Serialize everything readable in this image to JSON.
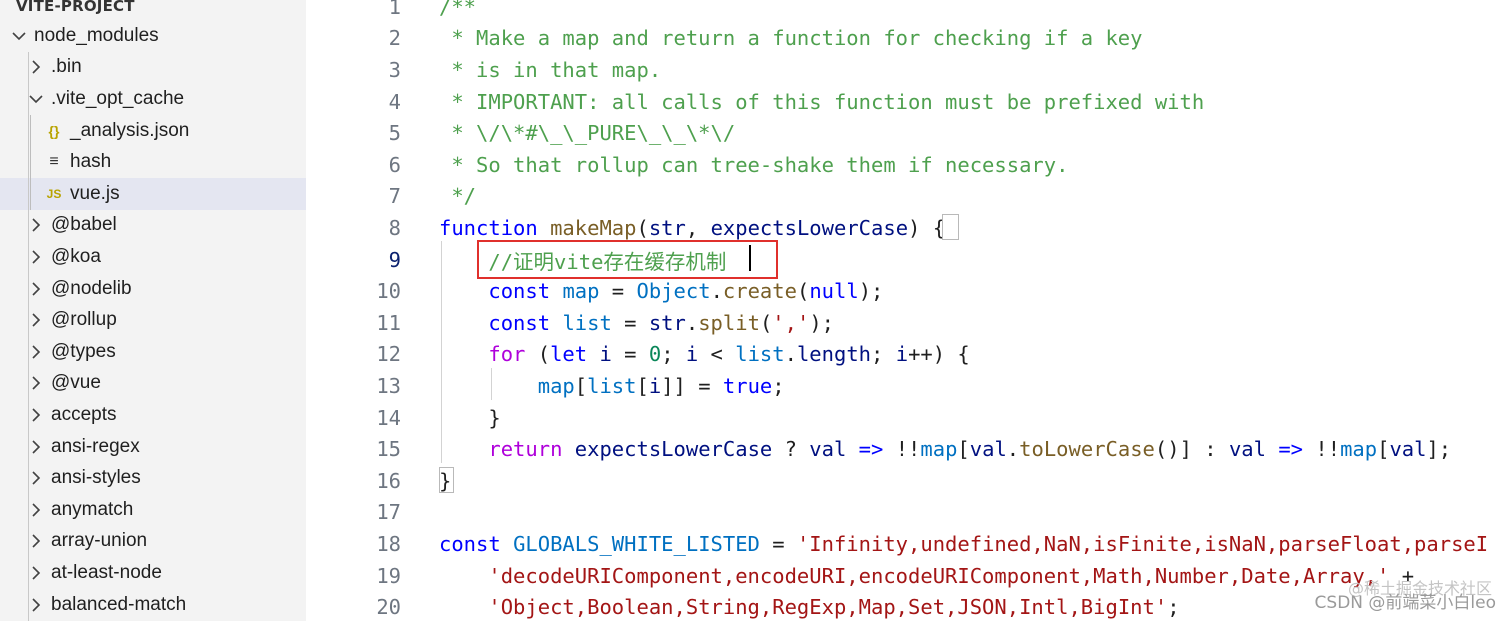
{
  "sidebar": {
    "project_title": "VITE-PROJECT",
    "items": [
      {
        "label": "node_modules",
        "depth": 0,
        "expanded": true,
        "kind": "folder"
      },
      {
        "label": ".bin",
        "depth": 1,
        "expanded": false,
        "kind": "folder"
      },
      {
        "label": ".vite_opt_cache",
        "depth": 1,
        "expanded": true,
        "kind": "folder"
      },
      {
        "label": "_analysis.json",
        "depth": 2,
        "kind": "json",
        "icon": "{}"
      },
      {
        "label": "hash",
        "depth": 2,
        "kind": "txt",
        "icon": "≡"
      },
      {
        "label": "vue.js",
        "depth": 2,
        "kind": "js",
        "icon": "JS",
        "selected": true
      },
      {
        "label": "@babel",
        "depth": 1,
        "expanded": false,
        "kind": "folder"
      },
      {
        "label": "@koa",
        "depth": 1,
        "expanded": false,
        "kind": "folder"
      },
      {
        "label": "@nodelib",
        "depth": 1,
        "expanded": false,
        "kind": "folder"
      },
      {
        "label": "@rollup",
        "depth": 1,
        "expanded": false,
        "kind": "folder"
      },
      {
        "label": "@types",
        "depth": 1,
        "expanded": false,
        "kind": "folder"
      },
      {
        "label": "@vue",
        "depth": 1,
        "expanded": false,
        "kind": "folder"
      },
      {
        "label": "accepts",
        "depth": 1,
        "expanded": false,
        "kind": "folder"
      },
      {
        "label": "ansi-regex",
        "depth": 1,
        "expanded": false,
        "kind": "folder"
      },
      {
        "label": "ansi-styles",
        "depth": 1,
        "expanded": false,
        "kind": "folder"
      },
      {
        "label": "anymatch",
        "depth": 1,
        "expanded": false,
        "kind": "folder"
      },
      {
        "label": "array-union",
        "depth": 1,
        "expanded": false,
        "kind": "folder"
      },
      {
        "label": "at-least-node",
        "depth": 1,
        "expanded": false,
        "kind": "folder"
      },
      {
        "label": "balanced-match",
        "depth": 1,
        "expanded": false,
        "kind": "folder"
      }
    ]
  },
  "editor": {
    "active_line": 9,
    "lines": [
      {
        "n": "1",
        "tokens": [
          [
            "/**",
            "comment"
          ]
        ]
      },
      {
        "n": "2",
        "tokens": [
          [
            " * Make a map and return a function for checking if a key",
            "comment"
          ]
        ]
      },
      {
        "n": "3",
        "tokens": [
          [
            " * is in that map.",
            "comment"
          ]
        ]
      },
      {
        "n": "4",
        "tokens": [
          [
            " * IMPORTANT: all calls of this function must be prefixed with",
            "comment"
          ]
        ]
      },
      {
        "n": "5",
        "tokens": [
          [
            " * \\/\\*#\\_\\_PURE\\_\\_\\*\\/",
            "comment"
          ]
        ]
      },
      {
        "n": "6",
        "tokens": [
          [
            " * So that rollup can tree-shake them if necessary.",
            "comment"
          ]
        ]
      },
      {
        "n": "7",
        "tokens": [
          [
            " */",
            "comment"
          ]
        ]
      },
      {
        "n": "8",
        "tokens": [
          [
            "function",
            "kw"
          ],
          [
            " ",
            "plain"
          ],
          [
            "makeMap",
            "fn"
          ],
          [
            "(",
            "plain"
          ],
          [
            "str",
            "var"
          ],
          [
            ", ",
            "plain"
          ],
          [
            "expectsLowerCase",
            "var"
          ],
          [
            ") {",
            "plain"
          ]
        ]
      },
      {
        "n": "9",
        "tokens": [
          [
            "    ",
            "plain"
          ],
          [
            "//证明vite存在缓存机制",
            "comment"
          ]
        ]
      },
      {
        "n": "10",
        "tokens": [
          [
            "    ",
            "plain"
          ],
          [
            "const",
            "kw"
          ],
          [
            " ",
            "plain"
          ],
          [
            "map",
            "const"
          ],
          [
            " = ",
            "plain"
          ],
          [
            "Object",
            "const"
          ],
          [
            ".",
            "plain"
          ],
          [
            "create",
            "fn"
          ],
          [
            "(",
            "plain"
          ],
          [
            "null",
            "kw"
          ],
          [
            ");",
            "plain"
          ]
        ]
      },
      {
        "n": "11",
        "tokens": [
          [
            "    ",
            "plain"
          ],
          [
            "const",
            "kw"
          ],
          [
            " ",
            "plain"
          ],
          [
            "list",
            "const"
          ],
          [
            " = ",
            "plain"
          ],
          [
            "str",
            "var"
          ],
          [
            ".",
            "plain"
          ],
          [
            "split",
            "fn"
          ],
          [
            "(",
            "plain"
          ],
          [
            "','",
            "str"
          ],
          [
            ");",
            "plain"
          ]
        ]
      },
      {
        "n": "12",
        "tokens": [
          [
            "    ",
            "plain"
          ],
          [
            "for",
            "kw2"
          ],
          [
            " (",
            "plain"
          ],
          [
            "let",
            "kw"
          ],
          [
            " ",
            "plain"
          ],
          [
            "i",
            "var"
          ],
          [
            " = ",
            "plain"
          ],
          [
            "0",
            "num"
          ],
          [
            "; ",
            "plain"
          ],
          [
            "i",
            "var"
          ],
          [
            " < ",
            "plain"
          ],
          [
            "list",
            "const"
          ],
          [
            ".",
            "plain"
          ],
          [
            "length",
            "var"
          ],
          [
            "; ",
            "plain"
          ],
          [
            "i",
            "var"
          ],
          [
            "++) {",
            "plain"
          ]
        ]
      },
      {
        "n": "13",
        "tokens": [
          [
            "        ",
            "plain"
          ],
          [
            "map",
            "const"
          ],
          [
            "[",
            "plain"
          ],
          [
            "list",
            "const"
          ],
          [
            "[",
            "plain"
          ],
          [
            "i",
            "var"
          ],
          [
            "]] = ",
            "plain"
          ],
          [
            "true",
            "kw"
          ],
          [
            ";",
            "plain"
          ]
        ]
      },
      {
        "n": "14",
        "tokens": [
          [
            "    }",
            "plain"
          ]
        ]
      },
      {
        "n": "15",
        "tokens": [
          [
            "    ",
            "plain"
          ],
          [
            "return",
            "kw2"
          ],
          [
            " ",
            "plain"
          ],
          [
            "expectsLowerCase",
            "var"
          ],
          [
            " ? ",
            "plain"
          ],
          [
            "val",
            "var"
          ],
          [
            " ",
            "plain"
          ],
          [
            "=>",
            "kw"
          ],
          [
            " !!",
            "plain"
          ],
          [
            "map",
            "const"
          ],
          [
            "[",
            "plain"
          ],
          [
            "val",
            "var"
          ],
          [
            ".",
            "plain"
          ],
          [
            "toLowerCase",
            "fn"
          ],
          [
            "()] : ",
            "plain"
          ],
          [
            "val",
            "var"
          ],
          [
            " ",
            "plain"
          ],
          [
            "=>",
            "kw"
          ],
          [
            " !!",
            "plain"
          ],
          [
            "map",
            "const"
          ],
          [
            "[",
            "plain"
          ],
          [
            "val",
            "var"
          ],
          [
            "];",
            "plain"
          ]
        ]
      },
      {
        "n": "16",
        "tokens": [
          [
            "}",
            "plain"
          ]
        ]
      },
      {
        "n": "17",
        "tokens": []
      },
      {
        "n": "18",
        "tokens": [
          [
            "const",
            "kw"
          ],
          [
            " ",
            "plain"
          ],
          [
            "GLOBALS_WHITE_LISTED",
            "const"
          ],
          [
            " = ",
            "plain"
          ],
          [
            "'Infinity,undefined,NaN,isFinite,isNaN,parseFloat,parseI",
            "str"
          ]
        ]
      },
      {
        "n": "19",
        "tokens": [
          [
            "    ",
            "plain"
          ],
          [
            "'decodeURIComponent,encodeURI,encodeURIComponent,Math,Number,Date,Array,'",
            "str"
          ],
          [
            " +",
            "plain"
          ]
        ]
      },
      {
        "n": "20",
        "tokens": [
          [
            "    ",
            "plain"
          ],
          [
            "'Object,Boolean,String,RegExp,Map,Set,JSON,Intl,BigInt'",
            "str"
          ],
          [
            ";",
            "plain"
          ]
        ]
      }
    ]
  },
  "watermark": {
    "line1": "@稀土掘金技术社区",
    "line2": "CSDN @前端菜小白leo"
  }
}
